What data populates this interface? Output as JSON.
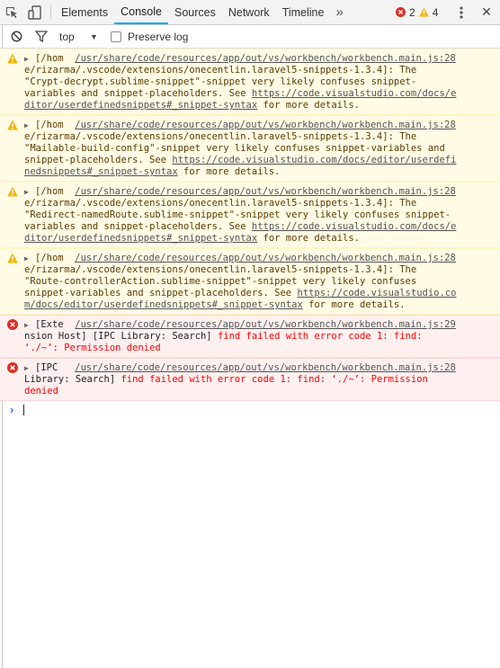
{
  "tabs": [
    {
      "label": "Elements",
      "active": false
    },
    {
      "label": "Console",
      "active": true
    },
    {
      "label": "Sources",
      "active": false
    },
    {
      "label": "Network",
      "active": false
    },
    {
      "label": "Timeline",
      "active": false
    }
  ],
  "more_tabs": "»",
  "counts": {
    "errors": "2",
    "warnings": "4"
  },
  "close": "✕",
  "filter": {
    "context": "top",
    "preserve_log": "Preserve log",
    "preserve_checked": false
  },
  "messages": [
    {
      "level": "warning",
      "lines": [
        [
          {
            "t": "tri",
            "v": "▶"
          },
          {
            "t": "text",
            "v": "[/hom  "
          },
          {
            "t": "link",
            "v": "/usr/share/code/resources/app/out/vs/workbench/workbench.main.js:28"
          }
        ],
        [
          {
            "t": "text",
            "v": "e/rizarma/.vscode/extensions/onecentlin.laravel5-snippets-1.3.4]: The"
          }
        ],
        [
          {
            "t": "text",
            "v": "\"Crypt-decrypt.sublime-snippet\"-snippet very likely confuses snippet-"
          }
        ],
        [
          {
            "t": "text",
            "v": "variables and snippet-placeholders. See "
          },
          {
            "t": "link",
            "v": "https://code.visualstudio.com/docs/e"
          }
        ],
        [
          {
            "t": "link",
            "v": "ditor/userdefinedsnippets#_snippet-syntax"
          },
          {
            "t": "text",
            "v": " for more details."
          }
        ]
      ]
    },
    {
      "level": "warning",
      "lines": [
        [
          {
            "t": "tri",
            "v": "▶"
          },
          {
            "t": "text",
            "v": "[/hom  "
          },
          {
            "t": "link",
            "v": "/usr/share/code/resources/app/out/vs/workbench/workbench.main.js:28"
          }
        ],
        [
          {
            "t": "text",
            "v": "e/rizarma/.vscode/extensions/onecentlin.laravel5-snippets-1.3.4]: The"
          }
        ],
        [
          {
            "t": "text",
            "v": "\"Mailable-build-config\"-snippet very likely confuses snippet-variables and"
          }
        ],
        [
          {
            "t": "text",
            "v": "snippet-placeholders. See "
          },
          {
            "t": "link",
            "v": "https://code.visualstudio.com/docs/editor/userdefi"
          }
        ],
        [
          {
            "t": "link",
            "v": "nedsnippets#_snippet-syntax"
          },
          {
            "t": "text",
            "v": " for more details."
          }
        ]
      ]
    },
    {
      "level": "warning",
      "lines": [
        [
          {
            "t": "tri",
            "v": "▶"
          },
          {
            "t": "text",
            "v": "[/hom  "
          },
          {
            "t": "link",
            "v": "/usr/share/code/resources/app/out/vs/workbench/workbench.main.js:28"
          }
        ],
        [
          {
            "t": "text",
            "v": "e/rizarma/.vscode/extensions/onecentlin.laravel5-snippets-1.3.4]: The"
          }
        ],
        [
          {
            "t": "text",
            "v": "\"Redirect-namedRoute.sublime-snippet\"-snippet very likely confuses snippet-"
          }
        ],
        [
          {
            "t": "text",
            "v": "variables and snippet-placeholders. See "
          },
          {
            "t": "link",
            "v": "https://code.visualstudio.com/docs/e"
          }
        ],
        [
          {
            "t": "link",
            "v": "ditor/userdefinedsnippets#_snippet-syntax"
          },
          {
            "t": "text",
            "v": " for more details."
          }
        ]
      ]
    },
    {
      "level": "warning",
      "lines": [
        [
          {
            "t": "tri",
            "v": "▶"
          },
          {
            "t": "text",
            "v": "[/hom  "
          },
          {
            "t": "link",
            "v": "/usr/share/code/resources/app/out/vs/workbench/workbench.main.js:28"
          }
        ],
        [
          {
            "t": "text",
            "v": "e/rizarma/.vscode/extensions/onecentlin.laravel5-snippets-1.3.4]: The"
          }
        ],
        [
          {
            "t": "text",
            "v": "\"Route-controllerAction.sublime-snippet\"-snippet very likely confuses"
          }
        ],
        [
          {
            "t": "text",
            "v": "snippet-variables and snippet-placeholders. See "
          },
          {
            "t": "link",
            "v": "https://code.visualstudio.co"
          }
        ],
        [
          {
            "t": "link",
            "v": "m/docs/editor/userdefinedsnippets#_snippet-syntax"
          },
          {
            "t": "text",
            "v": " for more details."
          }
        ]
      ]
    },
    {
      "level": "error",
      "lines": [
        [
          {
            "t": "tri",
            "v": "▶"
          },
          {
            "t": "plain",
            "v": "[Exte  "
          },
          {
            "t": "link",
            "v": "/usr/share/code/resources/app/out/vs/workbench/workbench.main.js:29"
          }
        ],
        [
          {
            "t": "plain",
            "v": "nsion Host] [IPC Library: Search] "
          },
          {
            "t": "text",
            "v": "find failed with error code 1: find:"
          }
        ],
        [
          {
            "t": "text",
            "v": "‘./~’: Permission denied"
          }
        ]
      ]
    },
    {
      "level": "error",
      "lines": [
        [
          {
            "t": "tri",
            "v": "▶"
          },
          {
            "t": "plain",
            "v": "[IPC   "
          },
          {
            "t": "link",
            "v": "/usr/share/code/resources/app/out/vs/workbench/workbench.main.js:28"
          }
        ],
        [
          {
            "t": "plain",
            "v": "Library: Search] "
          },
          {
            "t": "text",
            "v": "find failed with error code 1: find: ‘./~’: Permission"
          }
        ],
        [
          {
            "t": "text",
            "v": "denied"
          }
        ]
      ]
    }
  ],
  "prompt_symbol": "›",
  "colors": {
    "accent": "#03a9f4",
    "error": "#ff0000",
    "warning_bg": "#fffbe5",
    "error_bg": "#fff0f0"
  }
}
